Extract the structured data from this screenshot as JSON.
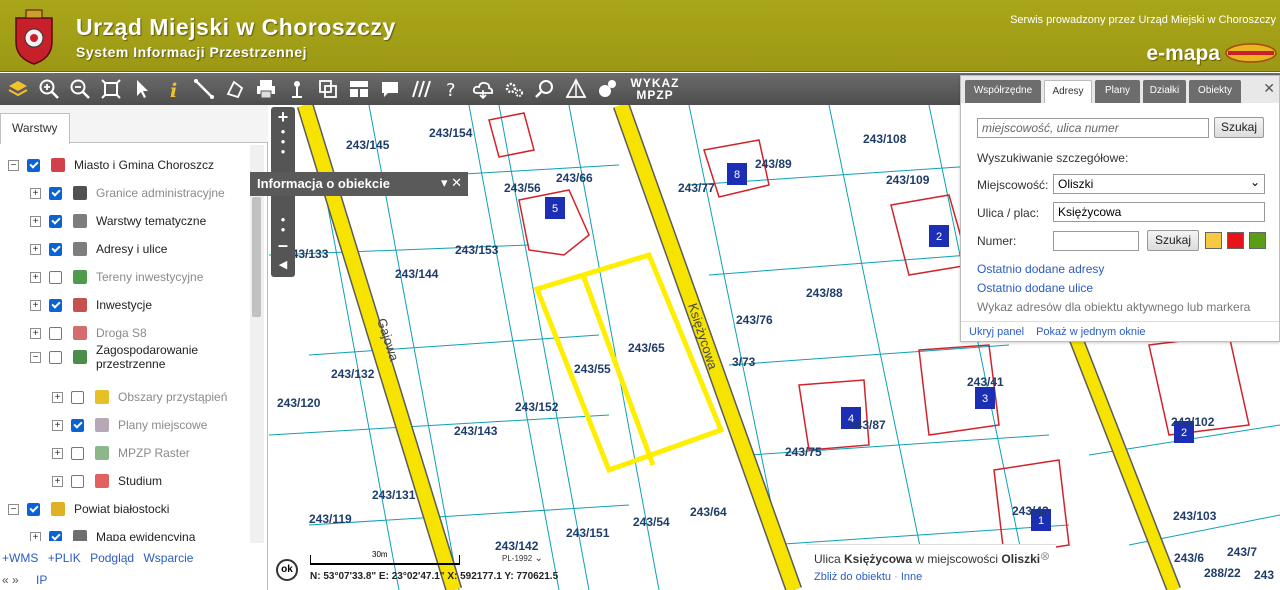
{
  "header": {
    "title": "Urząd Miejski w Choroszczy",
    "subtitle": "System Informacji Przestrzennej",
    "service_text": "Serwis prowadzony przez Urząd Miejski w Choroszczy",
    "brand": "e-mapa",
    "colors": {
      "header_bg": "#a9a61a",
      "toolbar_bg": "#5b5b5b"
    }
  },
  "toolbar": {
    "tools": [
      "layers-icon",
      "zoom-in-icon",
      "zoom-out-icon",
      "zoom-extent-icon",
      "pointer-icon",
      "info-icon",
      "measure-line-icon",
      "measure-area-icon",
      "print-icon",
      "location-icon",
      "copy-icon",
      "layout-icon",
      "comment-icon",
      "hatch-icon",
      "help-icon",
      "cloud-icon",
      "settings-icon",
      "search-map-icon",
      "triangle-icon",
      "chat-icon"
    ],
    "wykaz_line1": "WYKAZ",
    "wykaz_line2": "MPZP"
  },
  "left_panel": {
    "tab": "Warstwy",
    "layers": [
      {
        "label": "Miasto i Gmina Choroszcz",
        "checked": true,
        "grey": false,
        "icon": "crest-icon",
        "indent": 0
      },
      {
        "label": "Granice administracyjne",
        "checked": true,
        "grey": true,
        "icon": "boundary-icon",
        "indent": 1
      },
      {
        "label": "Warstwy tematyczne",
        "checked": true,
        "grey": false,
        "icon": "stack-icon",
        "indent": 1
      },
      {
        "label": "Adresy i ulice",
        "checked": true,
        "grey": false,
        "icon": "envelope-icon",
        "indent": 1
      },
      {
        "label": "Tereny inwestycyjne",
        "checked": false,
        "grey": true,
        "icon": "dollar-icon",
        "indent": 1
      },
      {
        "label": "Inwestycje",
        "checked": true,
        "grey": false,
        "icon": "crane-icon",
        "indent": 1
      },
      {
        "label": "Droga S8",
        "checked": false,
        "grey": true,
        "icon": "road-icon",
        "indent": 1
      },
      {
        "label": "Zagospodarowanie",
        "label2": "przestrzenne",
        "checked": false,
        "grey": false,
        "icon": "planning-icon",
        "indent": 1
      },
      {
        "label": "Obszary przystąpień",
        "checked": false,
        "grey": true,
        "icon": "area-icon",
        "indent": 2
      },
      {
        "label": "Plany miejscowe",
        "checked": true,
        "grey": true,
        "icon": "plan-icon",
        "indent": 2
      },
      {
        "label": "MPZP Raster",
        "checked": false,
        "grey": true,
        "icon": "raster-icon",
        "indent": 2
      },
      {
        "label": "Studium",
        "checked": false,
        "grey": false,
        "icon": "study-icon",
        "indent": 2
      },
      {
        "label": "Powiat białostocki",
        "checked": true,
        "grey": false,
        "icon": "county-crest-icon",
        "indent": 0
      },
      {
        "label": "Mapa ewidencyjna",
        "checked": true,
        "grey": false,
        "icon": "cadastral-icon",
        "indent": 1
      }
    ],
    "links": [
      "+WMS",
      "+PLIK",
      "Podgląd",
      "Wsparcie"
    ],
    "bottom_left": "«  »",
    "bottom_ip": "IP"
  },
  "map": {
    "info_title": "Informacja o obiekcie",
    "parcels": [
      "243/154",
      "243/145",
      "243/56",
      "243/66",
      "243/153",
      "243/133",
      "243/144",
      "243/132",
      "243/120",
      "243/143",
      "243/152",
      "243/55",
      "243/65",
      "243/131",
      "243/119",
      "243/151",
      "243/54",
      "243/64",
      "243/142",
      "243/108",
      "243/89",
      "243/77",
      "243/109",
      "243/88",
      "243/76",
      "3/73",
      "243/87",
      "243/75",
      "243/41",
      "243/102",
      "243/103",
      "243/42",
      "243/6",
      "243/7",
      "288/22",
      "243"
    ],
    "streets": [
      "Gajowa",
      "Księżycowa"
    ],
    "building_numbers": [
      "5",
      "8",
      "2",
      "4",
      "3",
      "2",
      "1"
    ],
    "scale_label": "30m",
    "projection": "PL-1992",
    "coords_text": "N: 53°07'33.8\" E: 23°02'47.1\"  X: 592177.1  Y: 770621.5",
    "ok_label": "ok",
    "popup": {
      "prefix": "Ulica ",
      "street": "Księżycowa",
      "middle": " w miejscowości ",
      "town": "Oliszki",
      "link1": "Zbliż do obiektu",
      "link2": "Inne"
    },
    "colors": {
      "road": "#f6e400",
      "highlight": "#ffee00",
      "parcel_line": "#0ea0b4",
      "building": "#d2232a",
      "label": "#1f3d6a"
    }
  },
  "search_panel": {
    "tabs": [
      "Współrzędne",
      "Adresy",
      "Plany",
      "Działki",
      "Obiekty"
    ],
    "active_tab": "Adresy",
    "quick_placeholder": "miejscowość, ulica numer",
    "search_label": "Szukaj",
    "detail_heading": "Wyszukiwanie szczegółowe:",
    "town_label": "Miejscowość:",
    "town_value": "Oliszki",
    "street_label": "Ulica / plac:",
    "street_value": "Księżycowa",
    "number_label": "Numer:",
    "number_value": "",
    "swatches": [
      "#f7c842",
      "#e8141b",
      "#5a9e16"
    ],
    "link_recent_addresses": "Ostatnio dodane adresy",
    "link_recent_streets": "Ostatnio dodane ulice",
    "link_address_list": "Wykaz adresów dla obiektu aktywnego lub markera",
    "footer_hide": "Ukryj panel",
    "footer_window": "Pokaż w jednym oknie"
  }
}
